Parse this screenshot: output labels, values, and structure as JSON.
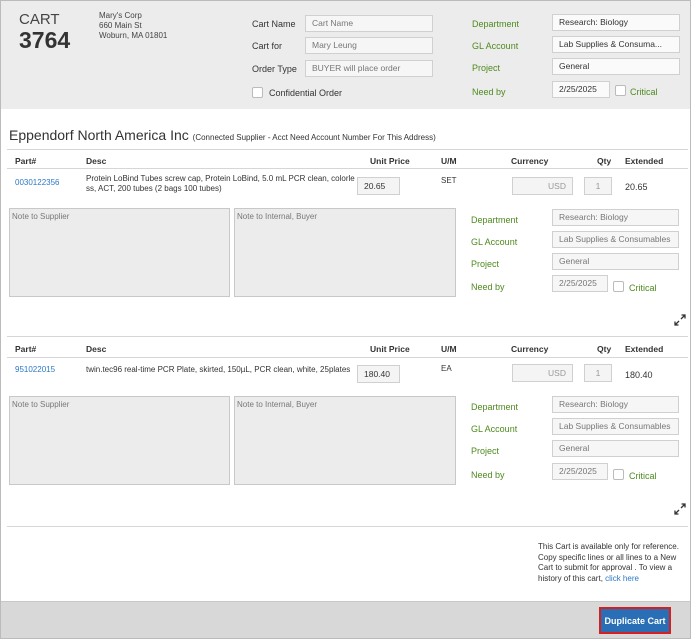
{
  "header": {
    "cart_label": "CART",
    "cart_number": "3764",
    "company": "Mary's Corp",
    "street": "660 Main St",
    "city": "Woburn, MA 01801",
    "cart_name_label": "Cart Name",
    "cart_name_placeholder": "Cart Name",
    "cart_for_label": "Cart for",
    "cart_for_value": "Mary Leung",
    "order_type_label": "Order Type",
    "order_type_value": "BUYER will place order",
    "confidential_label": "Confidential Order",
    "department_label": "Department",
    "department_value": "Research: Biology",
    "gl_account_label": "GL Account",
    "gl_account_value": "Lab Supplies & Consuma...",
    "project_label": "Project",
    "project_value": "General",
    "need_by_label": "Need by",
    "need_by_value": "2/25/2025",
    "critical_label": "Critical"
  },
  "supplier": {
    "name": "Eppendorf North America Inc",
    "note": "(Connected Supplier - Acct Need Account Number For This Address)"
  },
  "columns": {
    "part": "Part#",
    "desc": "Desc",
    "unit_price": "Unit Price",
    "um": "U/M",
    "currency": "Currency",
    "qty": "Qty",
    "extended": "Extended"
  },
  "lines": [
    {
      "part": "0030122356",
      "desc": "Protein LoBind Tubes screw cap, Protein LoBind, 5.0 mL PCR clean, colorle ss, ACT, 200 tubes (2 bags 100 tubes)",
      "unit_price": "20.65",
      "um": "SET",
      "currency": "USD",
      "qty": "1",
      "extended": "20.65",
      "note_supplier_placeholder": "Note to Supplier",
      "note_internal_placeholder": "Note to Internal, Buyer",
      "department_label": "Department",
      "department_value": "Research: Biology",
      "gl_account_label": "GL Account",
      "gl_account_value": "Lab Supplies & Consumables",
      "project_label": "Project",
      "project_value": "General",
      "need_by_label": "Need by",
      "need_by_value": "2/25/2025",
      "critical_label": "Critical"
    },
    {
      "part": "951022015",
      "desc": "twin.tec96 real-time PCR Plate, skirted, 150µL, PCR clean, white, 25plates",
      "unit_price": "180.40",
      "um": "EA",
      "currency": "USD",
      "qty": "1",
      "extended": "180.40",
      "note_supplier_placeholder": "Note to Supplier",
      "note_internal_placeholder": "Note to Internal, Buyer",
      "department_label": "Department",
      "department_value": "Research: Biology",
      "gl_account_label": "GL Account",
      "gl_account_value": "Lab Supplies & Consumables",
      "project_label": "Project",
      "project_value": "General",
      "need_by_label": "Need by",
      "need_by_value": "2/25/2025",
      "critical_label": "Critical"
    }
  ],
  "info": {
    "text": "This Cart is available only for reference. Copy specific lines or all lines to a New Cart to submit for approval . To view a history of this cart, ",
    "link": "click here"
  },
  "footer": {
    "duplicate_label": "Duplicate Cart"
  },
  "colors": {
    "accent_green": "#4e8a1e",
    "link_blue": "#2b78c5",
    "button_blue": "#2a6fb5",
    "highlight_red": "#d42020"
  }
}
